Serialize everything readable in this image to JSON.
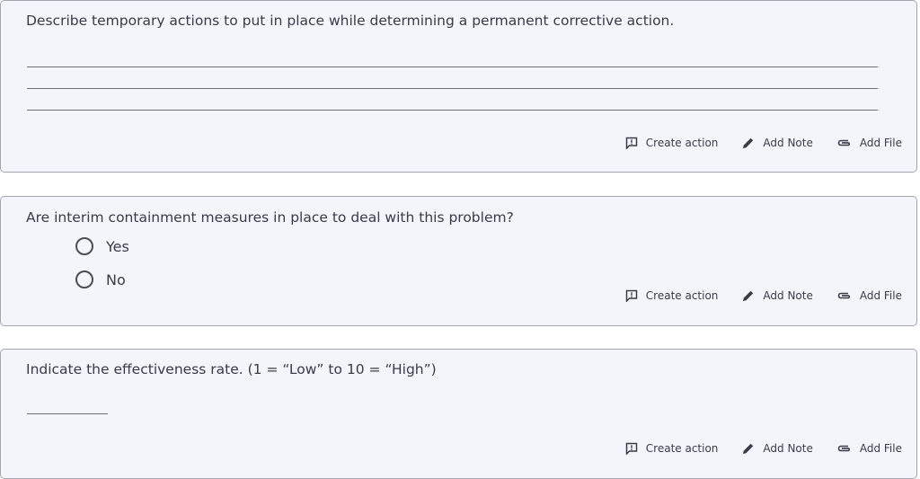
{
  "questions": [
    {
      "text": "Describe temporary actions to put in place while determining a permanent corrective action."
    },
    {
      "text": "Are interim containment measures in place to deal with this problem?",
      "options": [
        "Yes",
        "No"
      ]
    },
    {
      "text": "Indicate the effectiveness rate. (1 = “Low” to 10 = “High”)"
    }
  ],
  "actions": {
    "create": "Create action",
    "note": "Add Note",
    "file": "Add File"
  },
  "icons": {
    "create": "report-icon",
    "note": "pencil-icon",
    "file": "paperclip-icon"
  }
}
